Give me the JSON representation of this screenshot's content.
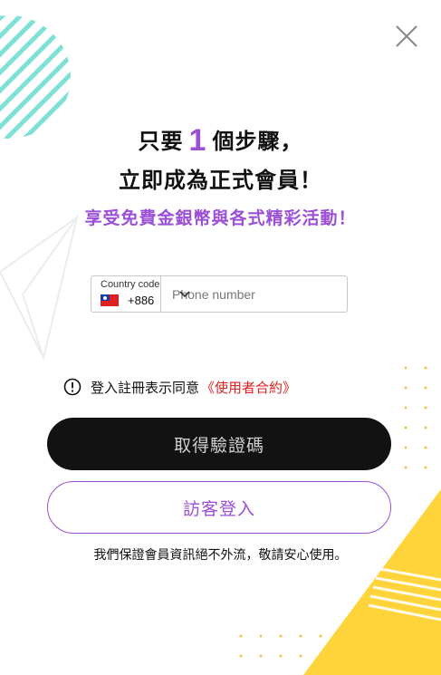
{
  "dialog": {
    "close_icon": "close-icon",
    "headline_prefix": "只要",
    "headline_number": "1",
    "headline_suffix": "個步驟，",
    "headline_line2": "立即成為正式會員！",
    "subtitle": "享受免費金銀幣與各式精彩活動！",
    "country_code_label": "Country code",
    "country_flag": "taiwan-flag",
    "country_code_value": "+886",
    "phone_placeholder": "Phone number",
    "phone_value": "",
    "agree_text": "登入註冊表示同意",
    "terms_link": "《使用者合約》",
    "primary_button": "取得驗證碼",
    "guest_button": "訪客登入",
    "secure_note": "我們保證會員資訊絕不外流，敬請安心使用。"
  },
  "colors": {
    "accent_purple": "#9b4fd6",
    "terms_red": "#e02020",
    "primary_button_bg": "#121212",
    "teal_stripes": "#7fe0d6",
    "yellow_accent": "#ffd43b"
  }
}
